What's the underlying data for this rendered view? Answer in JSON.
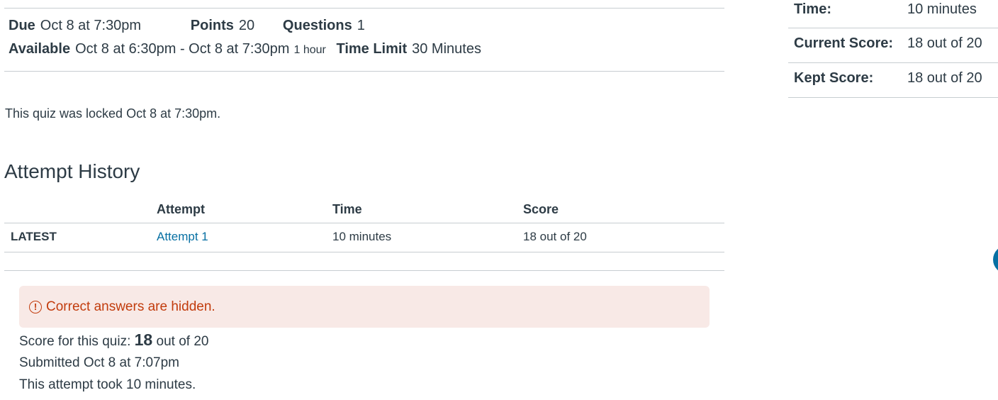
{
  "quiz_details": {
    "due_label": "Due",
    "due_value": "Oct 8 at 7:30pm",
    "points_label": "Points",
    "points_value": "20",
    "questions_label": "Questions",
    "questions_value": "1",
    "available_label": "Available",
    "available_value": "Oct 8 at 6:30pm - Oct 8 at 7:30pm",
    "available_duration": "1 hour",
    "time_limit_label": "Time Limit",
    "time_limit_value": "30 Minutes"
  },
  "locked_message": "This quiz was locked Oct 8 at 7:30pm.",
  "attempt_history": {
    "title": "Attempt History",
    "columns": [
      "",
      "Attempt",
      "Time",
      "Score"
    ],
    "rows": [
      {
        "tag": "LATEST",
        "attempt": "Attempt 1",
        "time": "10 minutes",
        "score": "18 out of 20"
      }
    ]
  },
  "alert": {
    "icon": "alert-circle-icon",
    "icon_glyph": "!",
    "text": "Correct answers are hidden."
  },
  "submission": {
    "score_prefix": "Score for this quiz:",
    "score_value": "18",
    "score_suffix": "out of 20",
    "submitted": "Submitted Oct 8 at 7:07pm",
    "duration": "This attempt took 10 minutes."
  },
  "sidebar": {
    "rows": [
      {
        "label": "Time:",
        "value": "10 minutes"
      },
      {
        "label": "Current Score:",
        "value": "18 out of 20"
      },
      {
        "label": "Kept Score:",
        "value": "18 out of 20"
      }
    ]
  },
  "colors": {
    "link": "#0770a3",
    "alert_background": "#f8e9e6",
    "alert_text": "#c23c0d",
    "divider": "#c7cdd1",
    "text": "#2d3b45"
  }
}
